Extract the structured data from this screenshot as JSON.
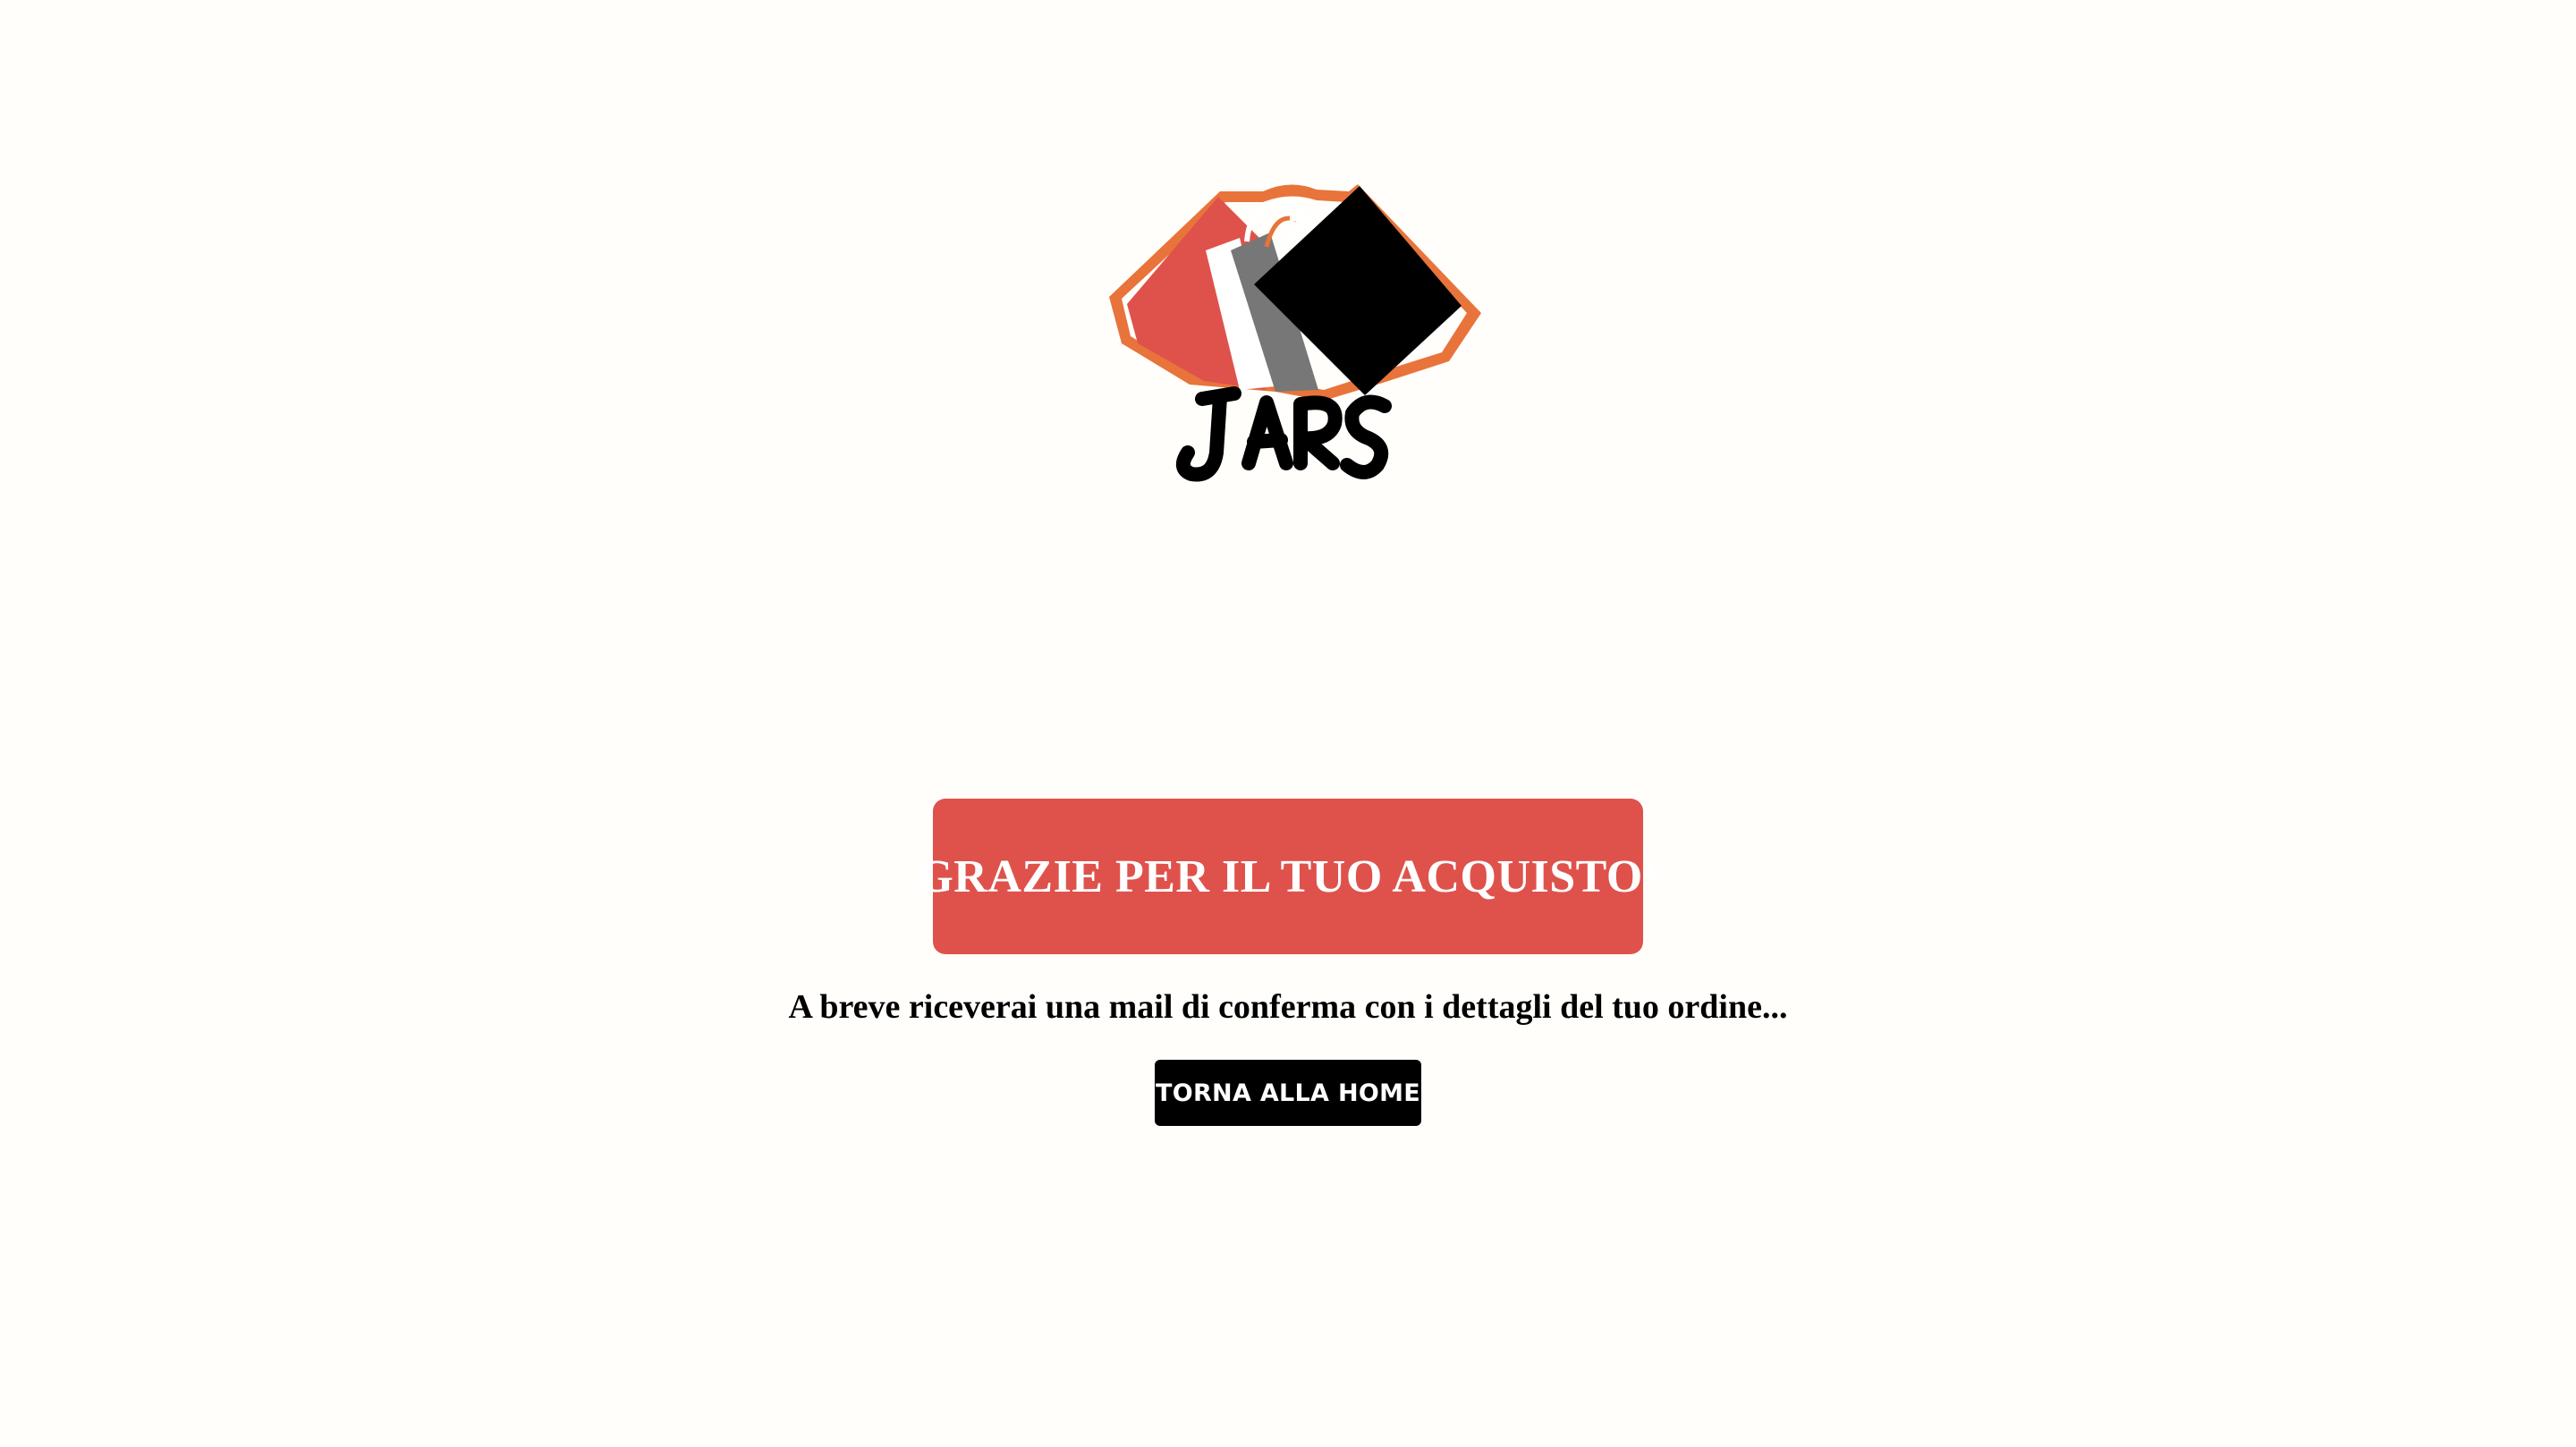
{
  "brand": {
    "logo_text": "JARS",
    "colors": {
      "accent_red": "#df524c",
      "logo_orange": "#e8743b",
      "logo_gray": "#777777",
      "black": "#000000",
      "background": "#fffefa"
    }
  },
  "main": {
    "title": "GRAZIE PER IL TUO ACQUISTO!",
    "message": "A breve riceverai una mail di conferma con i dettagli del tuo ordine...",
    "home_button_label": "TORNA ALLA HOME"
  }
}
